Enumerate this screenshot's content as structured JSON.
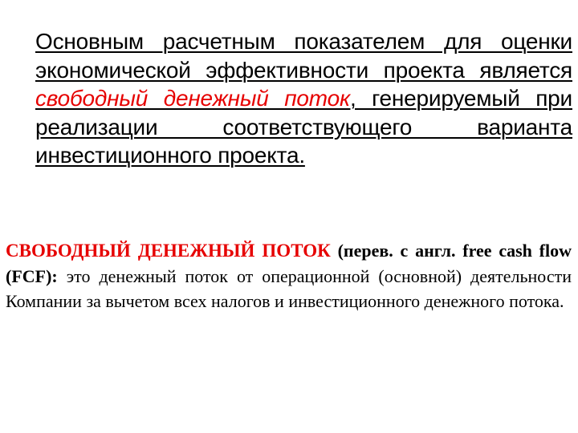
{
  "slide": {
    "paragraph1": {
      "text_before": "Основным расчетным показателем для оценки экономической эффективности проекта является ",
      "highlight": "свободный денежный поток",
      "text_after": ", генерируемый при реализации соответствующего варианта инвестиционного проекта."
    },
    "paragraph2": {
      "term": "СВОБОДНЫЙ ДЕНЕЖНЫЙ ПОТОК",
      "translation": " (перев. с англ. free cash flow (FCF):",
      "definition": " это денежный поток от операционной (основной) деятельности Компании за вычетом всех налогов и инвестиционного денежного потока."
    },
    "colors": {
      "accent": "#e60000",
      "text": "#000000",
      "background": "#ffffff"
    }
  }
}
